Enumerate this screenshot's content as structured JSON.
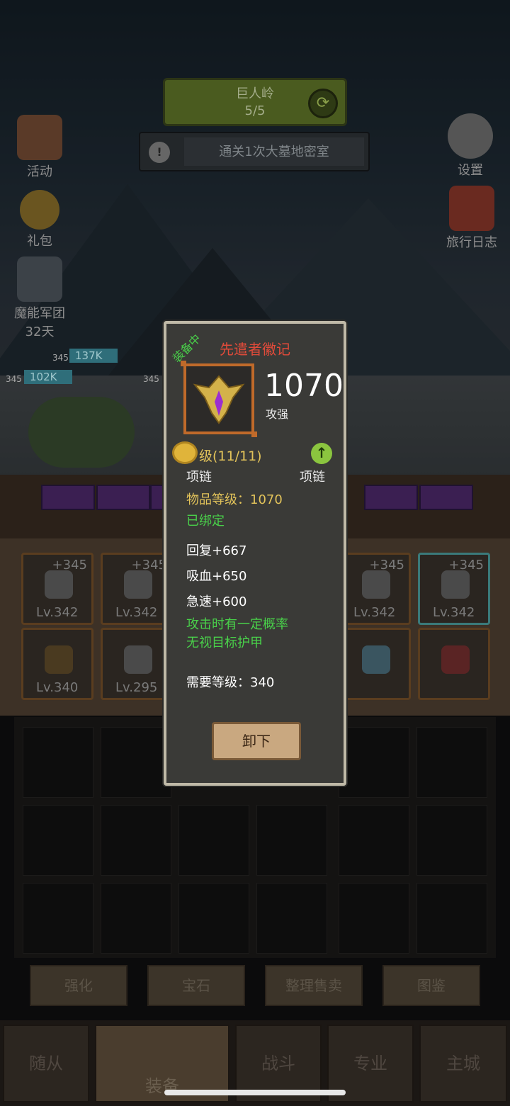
{
  "hud": {
    "quest_title": "巨人岭",
    "quest_progress": "5/5",
    "task_text": "通关1次大墓地密室",
    "left_buttons": [
      {
        "label": "活动",
        "icon": "scroll-icon"
      },
      {
        "label": "礼包",
        "icon": "gift-coin-icon"
      },
      {
        "label": "魔能军团",
        "sub": "32天",
        "icon": "legion-helmet-icon"
      }
    ],
    "right_buttons": [
      {
        "label": "设置",
        "icon": "gear-icon"
      },
      {
        "label": "旅行日志",
        "icon": "journal-icon"
      }
    ],
    "team": {
      "levels": [
        "345",
        "345",
        "345"
      ],
      "power": [
        "137K",
        "102K"
      ]
    }
  },
  "equipment": {
    "row1": [
      {
        "plus": "+345",
        "level": "Lv.342"
      },
      {
        "plus": "+345",
        "level": "Lv.342"
      },
      {
        "plus": "+345",
        "level": "Lv.342"
      },
      {
        "plus": "+345",
        "level": "Lv.342"
      }
    ],
    "row2": [
      {
        "level": "Lv.340"
      },
      {
        "level": "Lv.295"
      },
      {
        "level": ""
      },
      {
        "level": ""
      }
    ]
  },
  "actions": [
    "强化",
    "宝石",
    "整理售卖",
    "图鉴"
  ],
  "nav": [
    "随从",
    "装备",
    "战斗",
    "专业",
    "主城"
  ],
  "popup": {
    "equipped_tag": "装备中",
    "title": "先遣者徽记",
    "score": "1070",
    "score_label": "攻强",
    "level_text": "级(11/11)",
    "slot_left": "项链",
    "slot_right": "项链",
    "item_level": "物品等级：1070",
    "bound": "已绑定",
    "stats": [
      "回复+667",
      "吸血+650",
      "急速+600"
    ],
    "effect_line1": "攻击时有一定概率",
    "effect_line2": "无视目标护甲",
    "required_level": "需要等级：340",
    "unequip_label": "卸下"
  },
  "colors": {
    "title_red": "#e14b3a",
    "gold_text": "#e2c35a",
    "green_text": "#49d14a",
    "frame_orange": "#c06a2a"
  }
}
